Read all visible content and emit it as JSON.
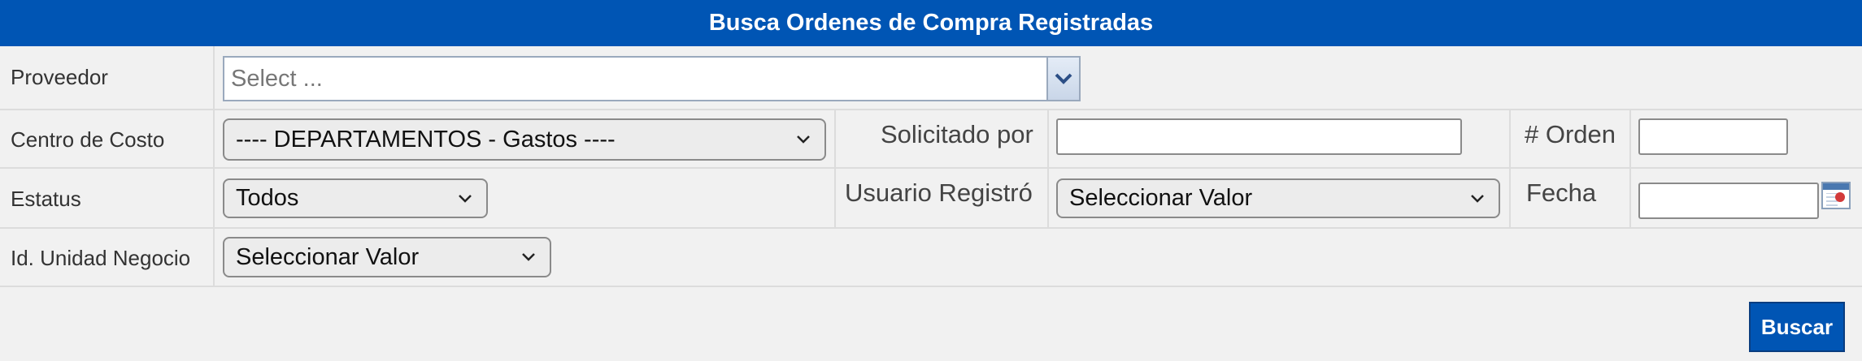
{
  "title": "Busca Ordenes de Compra Registradas",
  "fields": {
    "proveedor": {
      "label": "Proveedor",
      "placeholder": "Select ..."
    },
    "centro_costo": {
      "label": "Centro de Costo",
      "value": "---- DEPARTAMENTOS - Gastos ----"
    },
    "solicitado_por": {
      "label": "Solicitado por",
      "value": ""
    },
    "orden": {
      "label": "# Orden",
      "value": ""
    },
    "estatus": {
      "label": "Estatus",
      "value": "Todos"
    },
    "usuario_registro": {
      "label": "Usuario Registró",
      "value": "Seleccionar Valor"
    },
    "fecha": {
      "label": "Fecha",
      "value": ""
    },
    "unidad_negocio": {
      "label": "Id. Unidad Negocio",
      "value": "Seleccionar Valor"
    }
  },
  "buttons": {
    "search": "Buscar"
  },
  "icons": {
    "dropdown": "chevron-down-icon",
    "calendar": "calendar-icon"
  },
  "colors": {
    "header": "#0055b4",
    "panel": "#f1f1f1",
    "button": "#0055b4"
  }
}
